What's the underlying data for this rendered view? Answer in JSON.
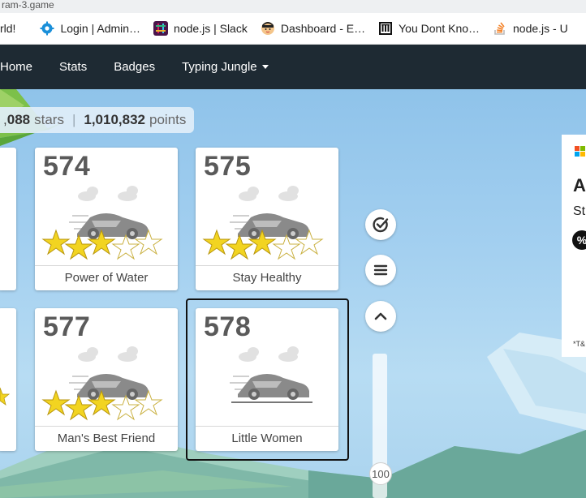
{
  "browser": {
    "url_fragment": "ram-3.game",
    "bookmarks": [
      {
        "label": "rld!",
        "icon": "none"
      },
      {
        "label": "Login | Admin…",
        "icon": "gear-icon"
      },
      {
        "label": "node.js | Slack",
        "icon": "slack-icon"
      },
      {
        "label": "Dashboard - E…",
        "icon": "avatar-icon"
      },
      {
        "label": "You Dont Kno…",
        "icon": "library-icon"
      },
      {
        "label": "node.js - U",
        "icon": "stackoverflow-icon"
      }
    ]
  },
  "nav": {
    "items": [
      "Home",
      "Stats",
      "Badges"
    ],
    "dropdown": "Typing Jungle"
  },
  "stats": {
    "stars": "088",
    "stars_prefix": ",",
    "stars_unit": "stars",
    "points": "1,010,832",
    "points_unit": "points"
  },
  "levels": [
    {
      "number": "574",
      "title": "Power of Water",
      "stars": 3
    },
    {
      "number": "575",
      "title": "Stay Healthy",
      "stars": 3
    },
    {
      "number": "577",
      "title": "Man's Best Friend",
      "stars": 3
    },
    {
      "number": "578",
      "title": "Little Women",
      "stars": 0
    }
  ],
  "controls": {
    "slider_value": "100"
  },
  "ad": {
    "heading": "A",
    "subheading": "St",
    "badge": "%",
    "footnote": "*T&"
  },
  "colors": {
    "nav_bg": "#1e2a33",
    "star_fill": "#f2d421",
    "selected_border": "#111111"
  }
}
